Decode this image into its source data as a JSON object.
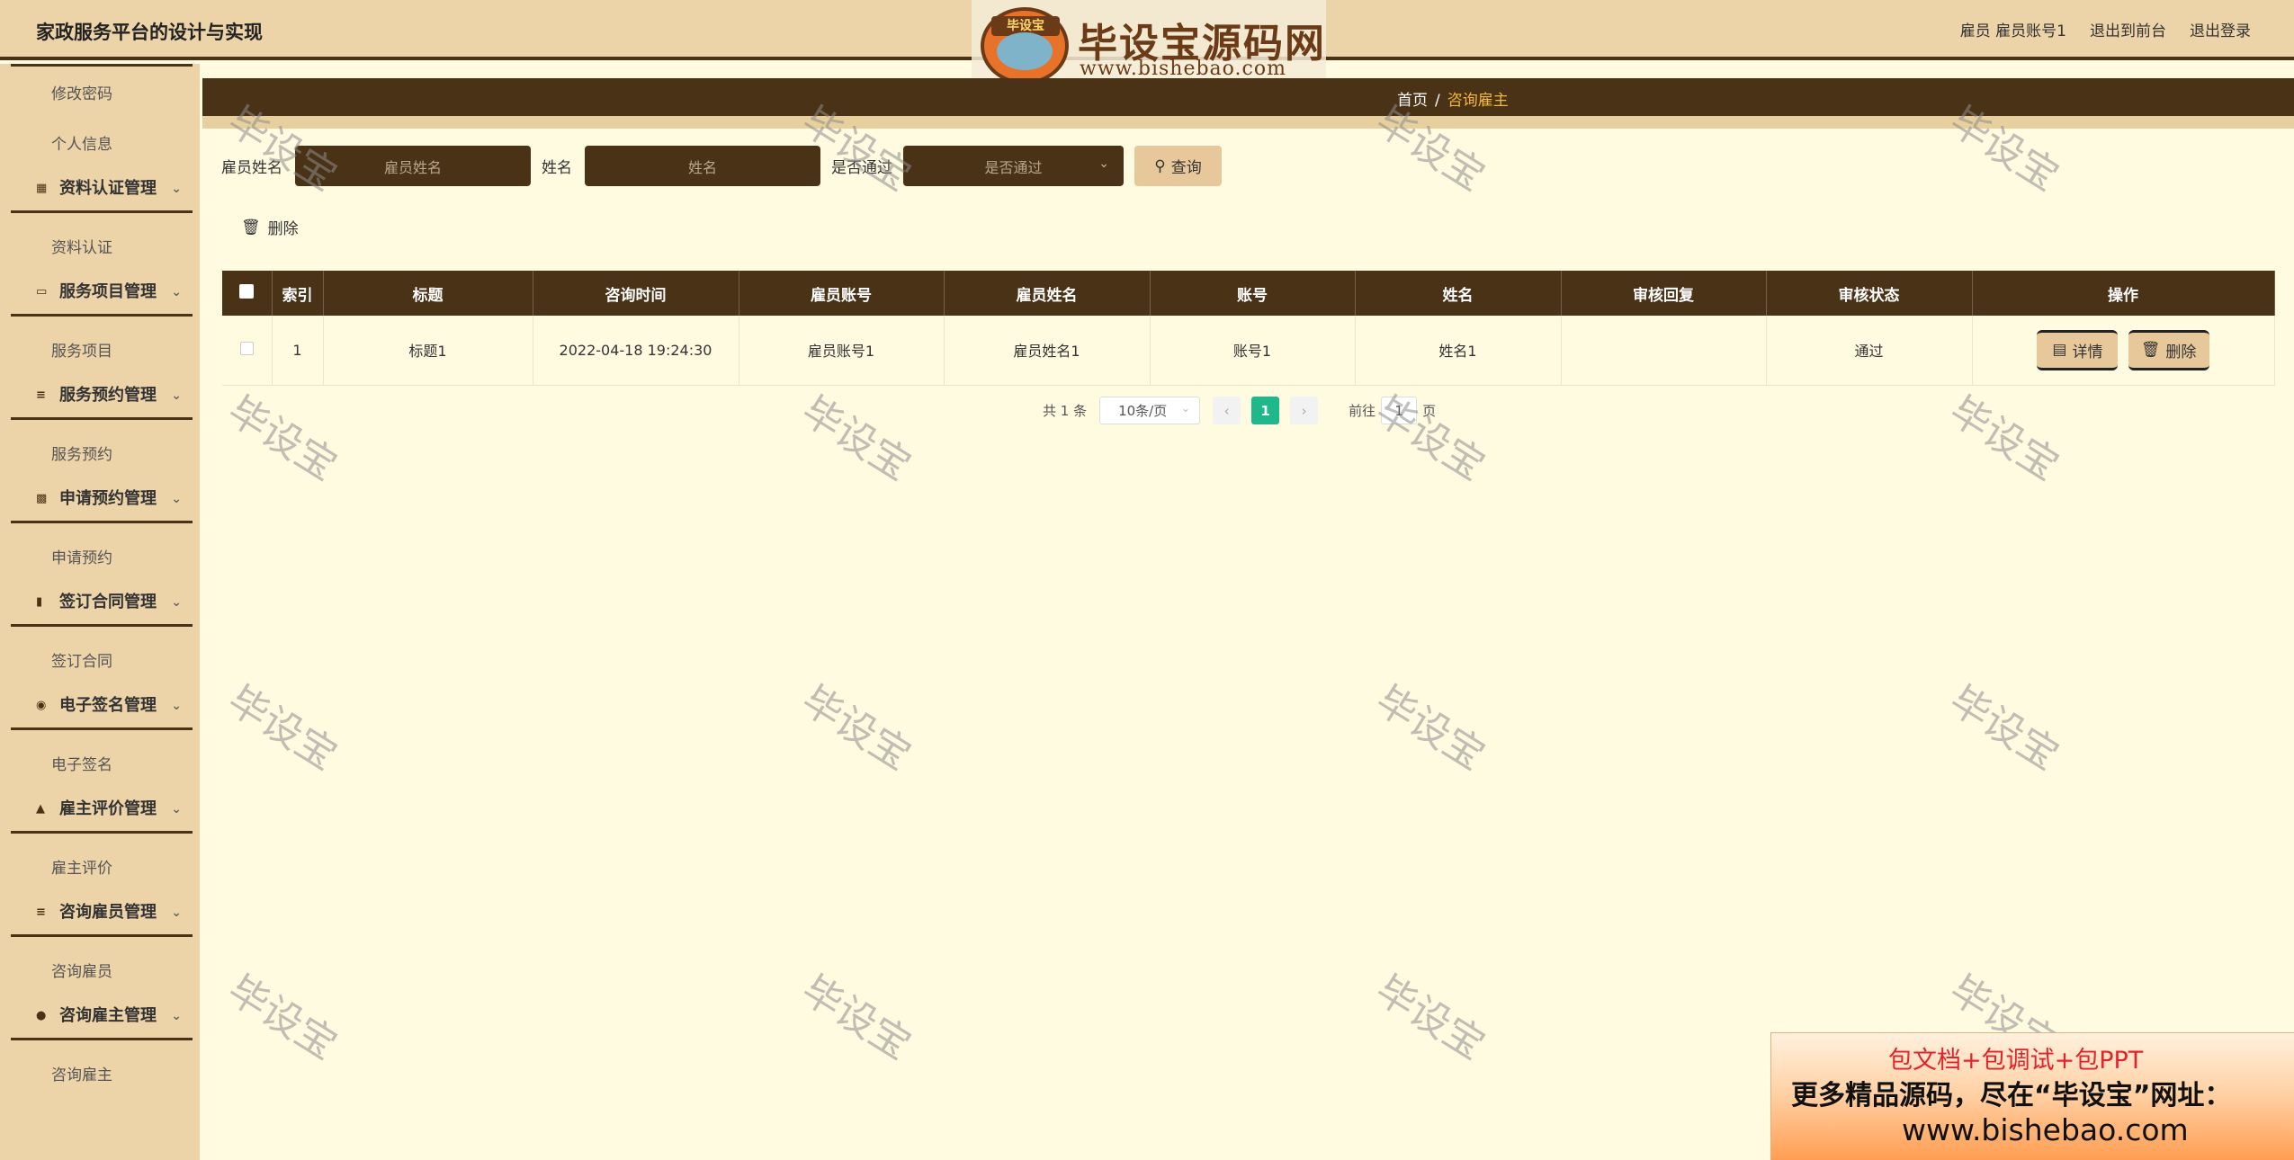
{
  "header": {
    "app_title": "家政服务平台的设计与实现",
    "user_label": "雇员 雇员账号1",
    "front_link": "退出到前台",
    "logout_link": "退出登录"
  },
  "brand": {
    "tag": "毕设宝",
    "name": "毕设宝源码网",
    "url": "www.bishebao.com"
  },
  "sidebar": {
    "items": [
      {
        "type": "sub",
        "label": "修改密码"
      },
      {
        "type": "sub",
        "label": "个人信息"
      },
      {
        "type": "group",
        "label": "资料认证管理",
        "icon": "id-card-icon"
      },
      {
        "type": "sub",
        "label": "资料认证"
      },
      {
        "type": "group",
        "label": "服务项目管理",
        "icon": "wallet-icon"
      },
      {
        "type": "sub",
        "label": "服务项目"
      },
      {
        "type": "group",
        "label": "服务预约管理",
        "icon": "sliders-icon"
      },
      {
        "type": "sub",
        "label": "服务预约"
      },
      {
        "type": "group",
        "label": "申请预约管理",
        "icon": "monitor-icon"
      },
      {
        "type": "sub",
        "label": "申请预约"
      },
      {
        "type": "group",
        "label": "签订合同管理",
        "icon": "books-icon"
      },
      {
        "type": "sub",
        "label": "签订合同"
      },
      {
        "type": "group",
        "label": "电子签名管理",
        "icon": "balloon-icon"
      },
      {
        "type": "sub",
        "label": "电子签名"
      },
      {
        "type": "group",
        "label": "雇主评价管理",
        "icon": "thumb-up-icon"
      },
      {
        "type": "sub",
        "label": "雇主评价"
      },
      {
        "type": "group",
        "label": "咨询雇员管理",
        "icon": "list-icon"
      },
      {
        "type": "sub",
        "label": "咨询雇员"
      },
      {
        "type": "group",
        "label": "咨询雇主管理",
        "icon": "user-icon"
      },
      {
        "type": "sub",
        "label": "咨询雇主"
      }
    ]
  },
  "breadcrumb": {
    "home": "首页",
    "separator": "/",
    "current": "咨询雇主"
  },
  "search": {
    "employee_name_label": "雇员姓名",
    "employee_name_placeholder": "雇员姓名",
    "name_label": "姓名",
    "name_placeholder": "姓名",
    "passed_label": "是否通过",
    "passed_placeholder": "是否通过",
    "query_button": "查询"
  },
  "toolbar": {
    "delete_label": "删除"
  },
  "table": {
    "columns": [
      "索引",
      "标题",
      "咨询时间",
      "雇员账号",
      "雇员姓名",
      "账号",
      "姓名",
      "审核回复",
      "审核状态",
      "操作"
    ],
    "rows": [
      {
        "index": "1",
        "title": "标题1",
        "time": "2022-04-18 19:24:30",
        "employee_account": "雇员账号1",
        "employee_name": "雇员姓名1",
        "account": "账号1",
        "name": "姓名1",
        "reply": "",
        "status": "通过",
        "detail_label": "详情",
        "delete_label": "删除"
      }
    ]
  },
  "pagination": {
    "total": "共 1 条",
    "page_size": "10条/页",
    "current_page": "1",
    "goto_prefix": "前往",
    "goto_value": "1",
    "goto_suffix": "页"
  },
  "watermark": "毕设宝",
  "ad": {
    "line1": "包文档+包调试+包PPT",
    "line2": "更多精品源码，尽在“毕设宝”网址：",
    "line3": "www.bishebao.com"
  },
  "colors": {
    "header_bg": "#ecd3a8",
    "dark_brown": "#4a3216",
    "page_bg": "#fffbe1",
    "button_tan": "#e7c89a",
    "accent_gold": "#f1b93a",
    "page_active": "#1fb88b"
  }
}
